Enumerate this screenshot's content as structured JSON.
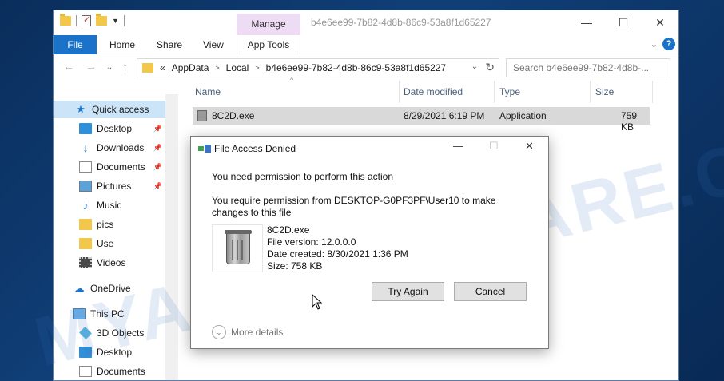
{
  "window": {
    "title": "b4e6ee99-7b82-4d8b-86c9-53a8f1d65227",
    "manage_label": "Manage",
    "controls": {
      "minimize": "—",
      "maximize": "☐",
      "close": "✕"
    }
  },
  "ribbon": {
    "tabs": [
      "File",
      "Home",
      "Share",
      "View",
      "App Tools"
    ]
  },
  "address": {
    "prefix": "«",
    "crumbs": [
      "AppData",
      "Local",
      "b4e6ee99-7b82-4d8b-86c9-53a8f1d65227"
    ],
    "search_placeholder": "Search b4e6ee99-7b82-4d8b-..."
  },
  "sidebar": {
    "items": [
      {
        "label": "Quick access",
        "icon": "star-icon"
      },
      {
        "label": "Desktop",
        "icon": "desktop-icon",
        "pinned": true
      },
      {
        "label": "Downloads",
        "icon": "download-icon",
        "pinned": true
      },
      {
        "label": "Documents",
        "icon": "document-icon",
        "pinned": true
      },
      {
        "label": "Pictures",
        "icon": "pictures-icon",
        "pinned": true
      },
      {
        "label": "Music",
        "icon": "music-icon"
      },
      {
        "label": "pics",
        "icon": "folder-icon"
      },
      {
        "label": "Use",
        "icon": "folder-icon"
      },
      {
        "label": "Videos",
        "icon": "videos-icon"
      },
      {
        "label": "OneDrive",
        "icon": "cloud-icon"
      },
      {
        "label": "This PC",
        "icon": "pc-icon"
      },
      {
        "label": "3D Objects",
        "icon": "3d-objects-icon"
      },
      {
        "label": "Desktop",
        "icon": "desktop-icon"
      },
      {
        "label": "Documents",
        "icon": "document-icon"
      }
    ]
  },
  "columns": {
    "name": "Name",
    "date": "Date modified",
    "type": "Type",
    "size": "Size"
  },
  "file_row": {
    "name": "8C2D.exe",
    "date": "8/29/2021 6:19 PM",
    "type": "Application",
    "size": "759 KB"
  },
  "watermark": "MYANTISPYWARE.COM",
  "dialog": {
    "title": "File Access Denied",
    "heading": "You need permission to perform this action",
    "permission": "You require permission from DESKTOP-G0PF3PF\\User10 to make changes to this file",
    "file": {
      "name": "8C2D.exe",
      "version": "File version: 12.0.0.0",
      "created": "Date created: 8/30/2021 1:36 PM",
      "size": "Size: 758 KB"
    },
    "try_again": "Try Again",
    "cancel": "Cancel",
    "more_details": "More details"
  }
}
